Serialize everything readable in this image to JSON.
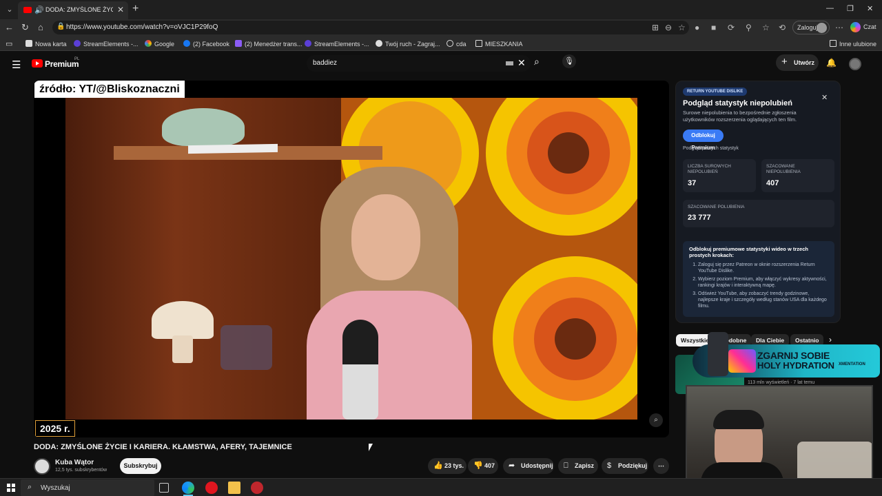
{
  "browser": {
    "tab_title": "DODA: ZMYŚLONE ŻYCIE I KARIERA. KŁAMSTWA, AFERY, TAJEMNICE",
    "url": "https://www.youtube.com/watch?v=oVJC1P29foQ",
    "login_label": "Zaloguj",
    "copilot_label": "Czat",
    "bookmarks": [
      "Nowa karta",
      "StreamElements -...",
      "Google",
      "(2) Facebook",
      "(2) Menedżer trans...",
      "StreamElements -...",
      "Twój ruch - Zagraj...",
      "cda",
      "MIESZKANIA"
    ],
    "other_favorites": "Inne ulubione"
  },
  "youtube": {
    "brand": "Premium",
    "country": "PL",
    "search_query": "baddiez",
    "create_label": "Utwórz"
  },
  "video": {
    "source_overlay": "źródło: YT/@Bliskoznaczni",
    "year_overlay": "2025 r.",
    "title": "DODA: ZMYŚLONE ŻYCIE I KARIERA. KŁAMSTWA, AFERY, TAJEMNICE",
    "channel_name": "Kuba Wątor",
    "subscribers": "12,5 tys. subskrybentów",
    "subscribe_label": "Subskrybuj",
    "likes": "23 tys.",
    "dislikes": "407",
    "share_label": "Udostępnij",
    "save_label": "Zapisz",
    "thanks_label": "Podziękuj"
  },
  "dislike_panel": {
    "tag": "RETURN YOUTUBE DISLIKE",
    "heading": "Podgląd statystyk niepolubień",
    "description": "Surowe niepolubienia to bezpośrednie zgłoszenia użytkowników rozszerzenia oglądających ten film.",
    "unlock_label": "Odblokuj Premium",
    "subtext": "Podgląd pełnych statystyk",
    "raw_dislikes_label": "Liczba surowych niepolubień",
    "raw_dislikes_value": "37",
    "est_dislikes_label": "Szacowane niepolubienia",
    "est_dislikes_value": "407",
    "est_likes_label": "Szacowane polubienia",
    "est_likes_value": "23 777",
    "promo_heading": "Odblokuj premiumowe statystyki wideo w trzech prostych krokach:",
    "steps": [
      "Zaloguj się przez Patreon w oknie rozszerzenia Return YouTube Dislike.",
      "Wybierz poziom Premium, aby włączyć wykresy aktywności, rankingi krajów i interaktywną mapę.",
      "Odśwież YouTube, aby zobaczyć trendy godzinowe, najlepsze kraje i szczegóły według stanów USA dla każdego filmu."
    ]
  },
  "chips": [
    "Wszystkie",
    "Podobne",
    "Dla Ciebie",
    "Ostatnio"
  ],
  "recommendation_meta": "113 mln wyświetleń · 7 lat temu",
  "ad": {
    "line1": "ZGARNIJ SOBIE",
    "line2": "HOLY HYDRATION",
    "brand": "XMENTATION"
  },
  "taskbar": {
    "search_placeholder": "Wyszukaj"
  },
  "colors": {
    "youtube_red": "#ff0000",
    "accent_blue": "#3a7bf5",
    "background": "#0f0f0f"
  }
}
